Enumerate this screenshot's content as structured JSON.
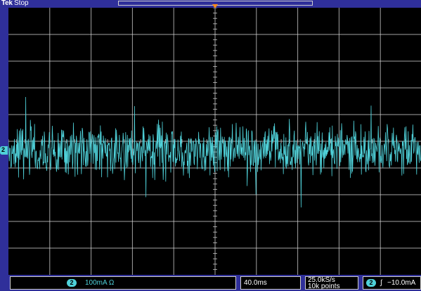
{
  "header": {
    "brand": "Tek",
    "acquisition_status": "Stop"
  },
  "channel_marker": {
    "label": "2"
  },
  "readouts": {
    "channel": {
      "number": "2",
      "scale_text": "100mA Ω"
    },
    "timebase": {
      "text": "40.0ms"
    },
    "sample": {
      "rate_text": "25.0kS/s",
      "points_text": "10k points"
    },
    "trigger": {
      "number": "2",
      "slope_glyph": "∫",
      "level_text": "−10.0mA"
    }
  },
  "colors": {
    "frame": "#2f2f9a",
    "grid": "#d8d8d8",
    "trace": "#4fd1d9",
    "trigger_marker": "#ff8c1a"
  }
}
